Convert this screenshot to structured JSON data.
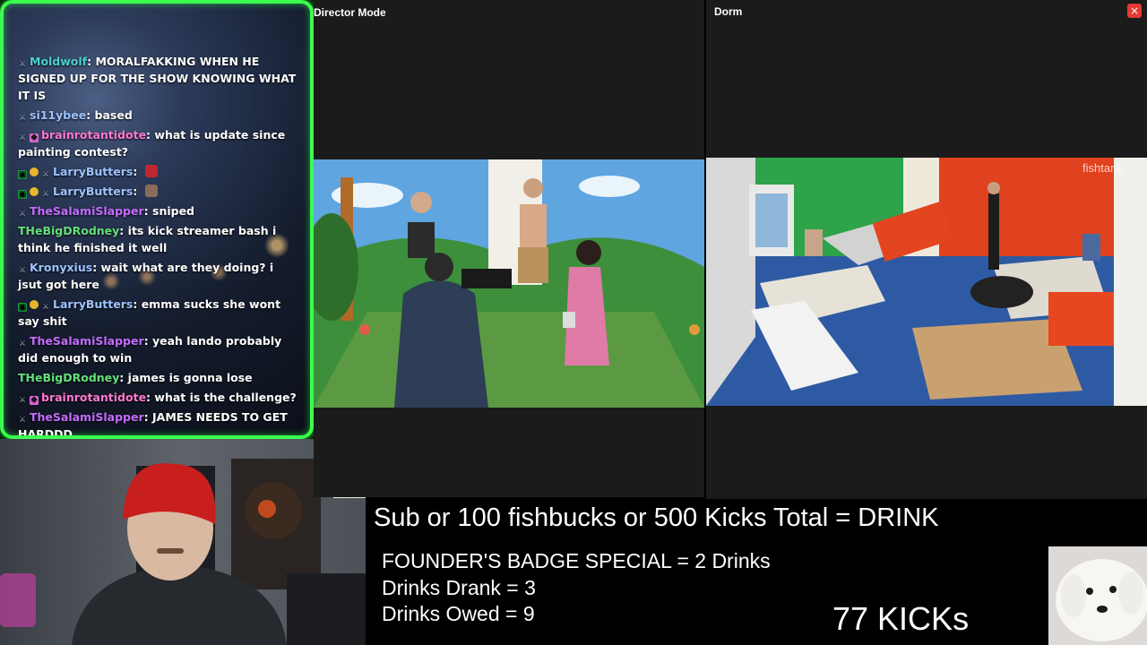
{
  "chat": {
    "messages": [
      {
        "user": "Moldwolf",
        "user_color": "#4ad0d0",
        "badges": [
          "mod"
        ],
        "text": "MORALFAKKING WHEN HE SIGNED UP FOR THE SHOW KNOWING WHAT IT IS"
      },
      {
        "user": "si11ybee",
        "user_color": "#9dc3ff",
        "badges": [
          "mod"
        ],
        "text": "based"
      },
      {
        "user": "brainrotantidote",
        "user_color": "#ff77d0",
        "badges": [
          "mod",
          "gift"
        ],
        "text": "what is update since painting contest?"
      },
      {
        "user": "LarryButters",
        "user_color": "#9dc3ff",
        "badges": [
          "sub",
          "coin",
          "mod"
        ],
        "text": "",
        "emote": "#c0282f"
      },
      {
        "user": "LarryButters",
        "user_color": "#9dc3ff",
        "badges": [
          "sub",
          "coin",
          "mod"
        ],
        "text": "",
        "emote": "#8b6b5a"
      },
      {
        "user": "TheSalamiSlapper",
        "user_color": "#c46cff",
        "badges": [
          "mod"
        ],
        "text": "sniped"
      },
      {
        "user": "THeBigDRodney",
        "user_color": "#63e07a",
        "badges": [],
        "text": "its kick streamer bash i think he finished it well"
      },
      {
        "user": "Kronyxius",
        "user_color": "#9dc3ff",
        "badges": [
          "mod"
        ],
        "text": "wait what are they doing? i jsut got here"
      },
      {
        "user": "LarryButters",
        "user_color": "#9dc3ff",
        "badges": [
          "sub",
          "coin",
          "mod"
        ],
        "text": "emma sucks she wont say shit"
      },
      {
        "user": "TheSalamiSlapper",
        "user_color": "#c46cff",
        "badges": [
          "mod"
        ],
        "text": "yeah lando probably did enough to win"
      },
      {
        "user": "THeBigDRodney",
        "user_color": "#63e07a",
        "badges": [],
        "text": "james is gonna lose"
      },
      {
        "user": "brainrotantidote",
        "user_color": "#ff77d0",
        "badges": [
          "mod",
          "gift"
        ],
        "text": "what is the challenge?"
      },
      {
        "user": "TheSalamiSlapper",
        "user_color": "#c46cff",
        "badges": [
          "mod"
        ],
        "text": "JAMES NEEDS TO GET HARDDD"
      }
    ]
  },
  "cams": {
    "left_title": "Director Mode",
    "right_title": "Dorm",
    "close_label": "×",
    "watermark": "fishtank"
  },
  "overlay": {
    "headline": "Sub or 100 fishbucks or 500 Kicks Total = DRINK",
    "founder": "FOUNDER'S BADGE SPECIAL = 2 Drinks",
    "drank": "Drinks Drank = 3",
    "owed": "Drinks Owed = 9",
    "kicks": "77 KICKs"
  },
  "colors": {
    "chat_border": "#3bff4f",
    "close_button": "#e53935"
  }
}
